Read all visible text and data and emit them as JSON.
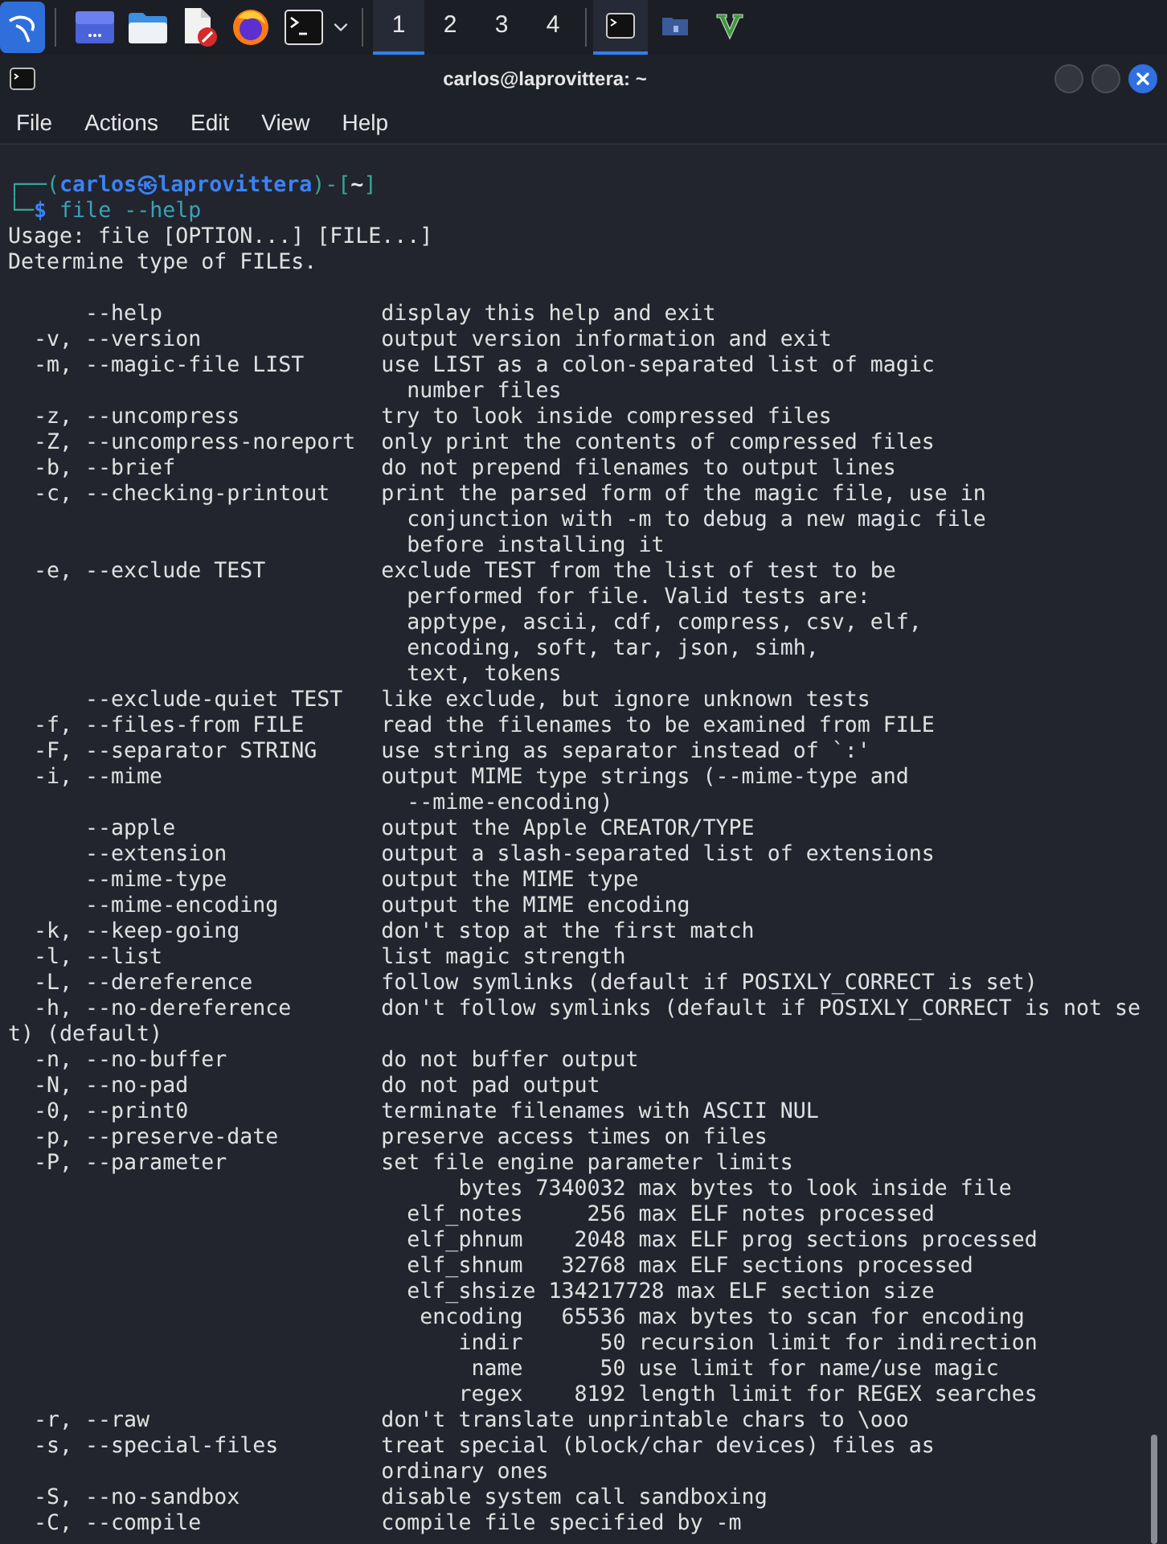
{
  "taskbar": {
    "launchers": [
      {
        "kind": "desktop"
      },
      {
        "kind": "files"
      },
      {
        "kind": "editor"
      },
      {
        "kind": "browser"
      },
      {
        "kind": "terminal"
      }
    ],
    "workspaces": [
      {
        "label": "1",
        "selected": true
      },
      {
        "label": "2",
        "selected": false
      },
      {
        "label": "3",
        "selected": false
      },
      {
        "label": "4",
        "selected": false
      }
    ],
    "windows": [
      {
        "kind": "terminal",
        "active": true
      },
      {
        "kind": "folder",
        "active": false
      },
      {
        "kind": "vim",
        "active": false
      }
    ]
  },
  "window": {
    "title": "carlos@laprovittera: ~"
  },
  "menu": [
    "File",
    "Actions",
    "Edit",
    "View",
    "Help"
  ],
  "prompt": {
    "open": "┌──(",
    "user_host": "carlos㉿laprovittera",
    "close": ")-[",
    "dir": "~",
    "end": "]",
    "corner": "└─",
    "sign": "$",
    "command": "file --help"
  },
  "output_blocks": [
    [
      "Usage: file [OPTION...] [FILE...]",
      "Determine type of FILEs."
    ],
    [
      "      --help                 display this help and exit",
      "  -v, --version              output version information and exit",
      "  -m, --magic-file LIST      use LIST as a colon-separated list of magic",
      "                               number files",
      "  -z, --uncompress           try to look inside compressed files",
      "  -Z, --uncompress-noreport  only print the contents of compressed files",
      "  -b, --brief                do not prepend filenames to output lines",
      "  -c, --checking-printout    print the parsed form of the magic file, use in",
      "                               conjunction with -m to debug a new magic file",
      "                               before installing it",
      "  -e, --exclude TEST         exclude TEST from the list of test to be",
      "                               performed for file. Valid tests are:",
      "                               apptype, ascii, cdf, compress, csv, elf,",
      "                               encoding, soft, tar, json, simh,",
      "                               text, tokens",
      "      --exclude-quiet TEST   like exclude, but ignore unknown tests",
      "  -f, --files-from FILE      read the filenames to be examined from FILE",
      "  -F, --separator STRING     use string as separator instead of `:'",
      "  -i, --mime                 output MIME type strings (--mime-type and",
      "                               --mime-encoding)",
      "      --apple                output the Apple CREATOR/TYPE",
      "      --extension            output a slash-separated list of extensions",
      "      --mime-type            output the MIME type",
      "      --mime-encoding        output the MIME encoding",
      "  -k, --keep-going           don't stop at the first match",
      "  -l, --list                 list magic strength",
      "  -L, --dereference          follow symlinks (default if POSIXLY_CORRECT is set)",
      "  -h, --no-dereference       don't follow symlinks (default if POSIXLY_CORRECT is not se",
      "t) (default)",
      "  -n, --no-buffer            do not buffer output",
      "  -N, --no-pad               do not pad output",
      "  -0, --print0               terminate filenames with ASCII NUL",
      "  -p, --preserve-date        preserve access times on files",
      "  -P, --parameter            set file engine parameter limits",
      "                                   bytes 7340032 max bytes to look inside file",
      "                               elf_notes     256 max ELF notes processed",
      "                               elf_phnum    2048 max ELF prog sections processed",
      "                               elf_shnum   32768 max ELF sections processed",
      "                               elf_shsize 134217728 max ELF section size",
      "                                encoding   65536 max bytes to scan for encoding",
      "                                   indir      50 recursion limit for indirection",
      "                                    name      50 use limit for name/use magic",
      "                                   regex    8192 length limit for REGEX searches",
      "  -r, --raw                  don't translate unprintable chars to \\ooo",
      "  -s, --special-files        treat special (block/char devices) files as",
      "                             ordinary ones",
      "  -S, --no-sandbox           disable system call sandboxing",
      "  -C, --compile              compile file specified by -m"
    ]
  ]
}
